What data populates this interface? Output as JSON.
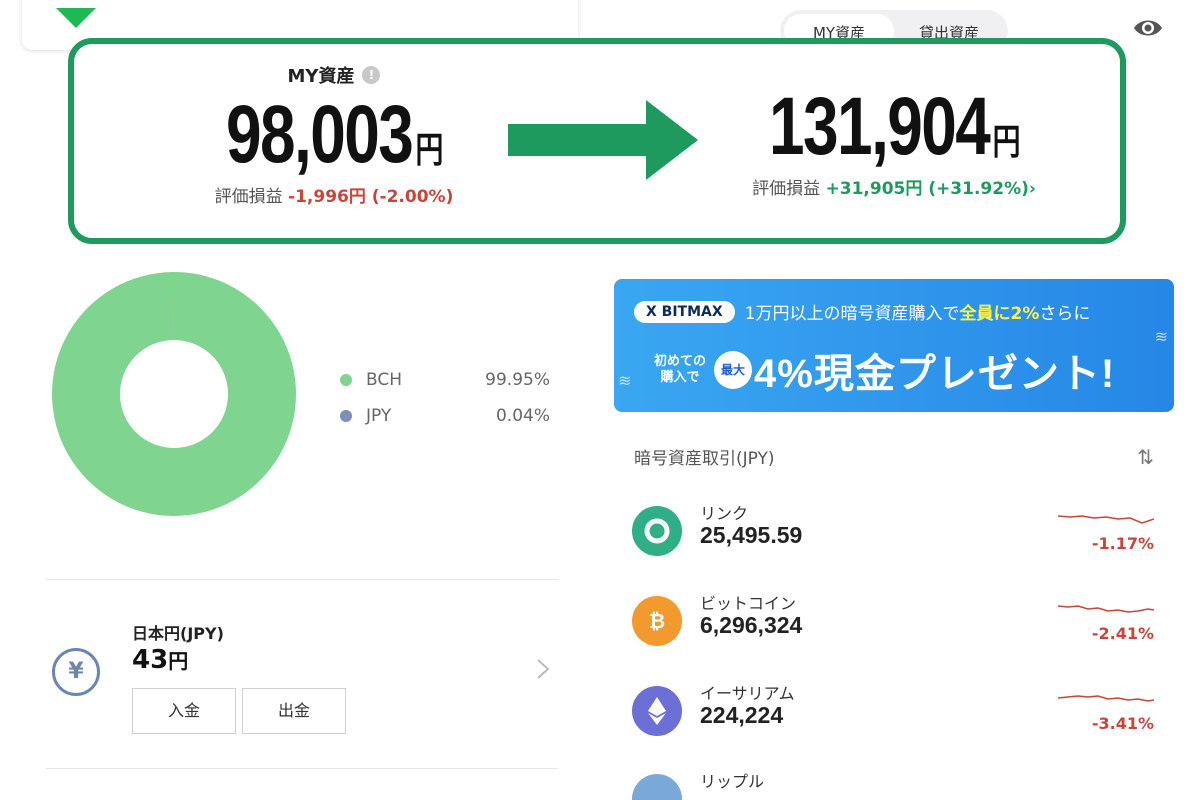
{
  "header": {
    "tabs": [
      {
        "label": "MY資産",
        "active": true
      },
      {
        "label": "貸出資産",
        "active": false
      }
    ],
    "eye_icon": "eye-icon"
  },
  "highlight": {
    "before": {
      "title": "MY資産",
      "amount": "98,003",
      "currency": "円",
      "pl_label": "評価損益",
      "pl_value": "-1,996円 (-2.00%)"
    },
    "after": {
      "amount": "131,904",
      "currency": "円",
      "pl_label": "評価損益",
      "pl_value": "+31,905円 (+31.92%)",
      "chevron": "›"
    },
    "arrow_color": "#1e9a5e",
    "border_color": "#1e9a5e"
  },
  "allocation": {
    "items": [
      {
        "name": "BCH",
        "percent": "99.95%",
        "value": 99.95,
        "color": "#7fd48f"
      },
      {
        "name": "JPY",
        "percent": "0.04%",
        "value": 0.04,
        "color": "#7b8fba"
      }
    ]
  },
  "jpy_wallet": {
    "icon": "¥",
    "label": "日本円(JPY)",
    "amount": "43",
    "currency": "円",
    "deposit_label": "入金",
    "withdraw_label": "出金"
  },
  "banner": {
    "brand": "X BITMAX",
    "text_pre": "1万円以上の暗号資産購入で",
    "text_highlight": "全員に2%",
    "text_post": "さらに",
    "first_purchase_line1": "初めての",
    "first_purchase_line2": "購入で",
    "max_badge": "最大",
    "promo": "4%現金プレゼント!"
  },
  "crypto_list": {
    "title": "暗号資産取引(JPY)",
    "sort_icon": "⇅",
    "coins": [
      {
        "name": "リンク",
        "price": "25,495.59",
        "change": "-1.17%",
        "icon": "◉",
        "color": "#2fae87"
      },
      {
        "name": "ビットコイン",
        "price": "6,296,324",
        "change": "-2.41%",
        "icon": "₿",
        "color": "#f29a2e"
      },
      {
        "name": "イーサリアム",
        "price": "224,224",
        "change": "-3.41%",
        "icon": "◆",
        "color": "#6b6fd6"
      },
      {
        "name": "リップル",
        "price": "",
        "change": "",
        "icon": "",
        "color": "#7aa8d8"
      }
    ]
  },
  "colors": {
    "negative": "#c8453a",
    "positive": "#1e9a5e",
    "accent": "#1e9a5e"
  }
}
